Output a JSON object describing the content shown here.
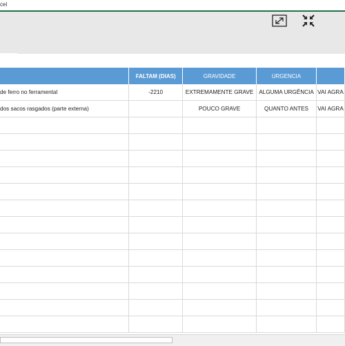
{
  "window": {
    "title": "cel"
  },
  "controls": {
    "expand_icon": "expand-arrows-icon",
    "compress_icon": "compress-arrows-icon"
  },
  "colors": {
    "header_bg": "#5b9bd5",
    "ribbon_bg": "#e8e8e8",
    "accent_green": "#1e7145"
  },
  "table": {
    "headers": [
      "",
      "FALTAM (DIAS)",
      "GRAVIDADE",
      "URGENCIA",
      ""
    ],
    "rows": [
      [
        "de ferro no ferramental",
        "-2210",
        "EXTREMAMENTE GRAVE",
        "ALGUMA URGÊNCIA",
        "VAI AGRA"
      ],
      [
        "dos sacos rasgados (parte externa)",
        "",
        "POUCO GRAVE",
        "QUANTO ANTES",
        "VAI AGRA"
      ],
      [
        "",
        "",
        "",
        "",
        ""
      ],
      [
        "",
        "",
        "",
        "",
        ""
      ],
      [
        "",
        "",
        "",
        "",
        ""
      ],
      [
        "",
        "",
        "",
        "",
        ""
      ],
      [
        "",
        "",
        "",
        "",
        ""
      ],
      [
        "",
        "",
        "",
        "",
        ""
      ],
      [
        "",
        "",
        "",
        "",
        ""
      ],
      [
        "",
        "",
        "",
        "",
        ""
      ],
      [
        "",
        "",
        "",
        "",
        ""
      ],
      [
        "",
        "",
        "",
        "",
        ""
      ],
      [
        "",
        "",
        "",
        "",
        ""
      ],
      [
        "",
        "",
        "",
        "",
        ""
      ],
      [
        "",
        "",
        "",
        "",
        ""
      ]
    ]
  }
}
